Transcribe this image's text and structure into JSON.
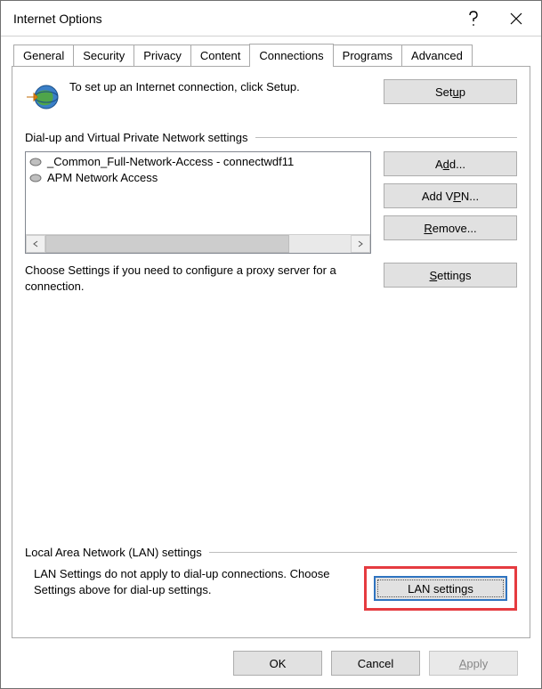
{
  "window": {
    "title": "Internet Options"
  },
  "tabs": {
    "items": [
      "General",
      "Security",
      "Privacy",
      "Content",
      "Connections",
      "Programs",
      "Advanced"
    ],
    "activeIndex": 4
  },
  "intro": {
    "text": "To set up an Internet connection, click Setup.",
    "setup_pre": "Set",
    "setup_mn": "u",
    "setup_post": "p"
  },
  "dvpn": {
    "header": "Dial-up and Virtual Private Network settings",
    "items": [
      "_Common_Full-Network-Access - connectwdf11",
      "APM Network Access"
    ],
    "add_pre": "A",
    "add_mn": "d",
    "add_post": "d...",
    "addvpn_pre": "Add V",
    "addvpn_mn": "P",
    "addvpn_post": "N...",
    "remove_pre": "",
    "remove_mn": "R",
    "remove_post": "emove...",
    "settings_pre": "",
    "settings_mn": "S",
    "settings_post": "ettings",
    "proxy_text": "Choose Settings if you need to configure a proxy server for a connection."
  },
  "lan": {
    "header": "Local Area Network (LAN) settings",
    "text": "LAN Settings do not apply to dial-up connections. Choose Settings above for dial-up settings.",
    "btn_pre": "",
    "btn_mn": "L",
    "btn_post": "AN settings"
  },
  "footer": {
    "ok": "OK",
    "cancel": "Cancel",
    "apply_pre": "",
    "apply_mn": "A",
    "apply_post": "pply"
  }
}
